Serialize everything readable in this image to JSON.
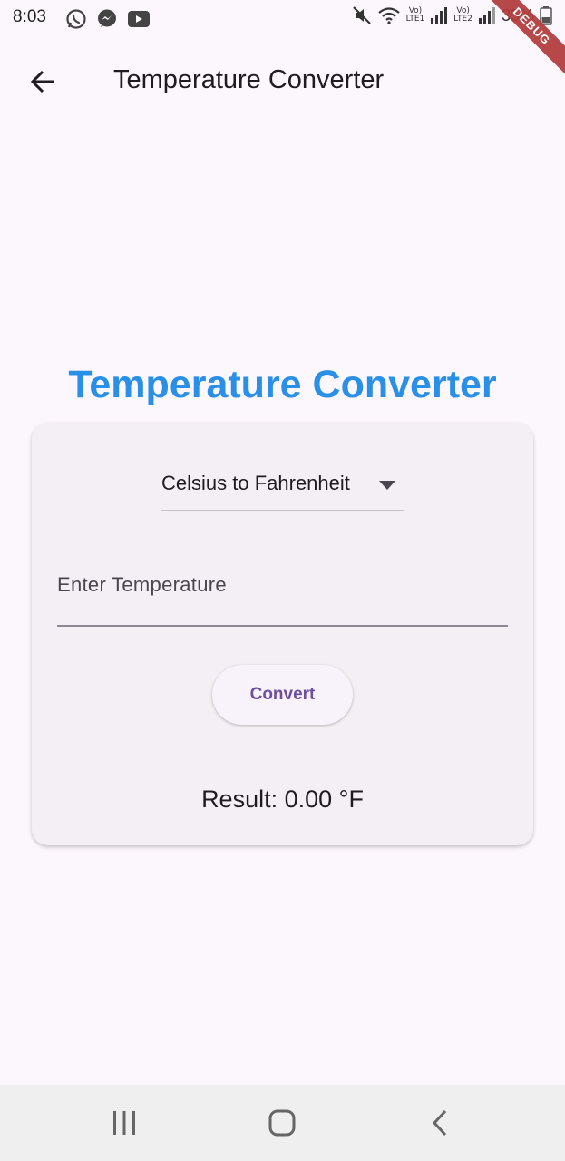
{
  "status_bar": {
    "time": "8:03",
    "left_icons": [
      "whatsapp-icon",
      "messenger-icon",
      "youtube-icon"
    ],
    "right_icons": [
      "mute-icon",
      "wifi-icon",
      "signal-lte1-icon",
      "signal-lte2-icon",
      "battery-icon"
    ],
    "lte1_label": "Vo) LTE1",
    "lte2_label": "Vo) LTE2",
    "battery_percent": "35%"
  },
  "debug_banner": "DEBUG",
  "app_bar": {
    "title": "Temperature Converter",
    "back_icon": "arrow-left-icon"
  },
  "main": {
    "heading": "Temperature Converter",
    "heading_color": "#2A8FE6",
    "dropdown": {
      "selected": "Celsius to Fahrenheit"
    },
    "input": {
      "placeholder": "Enter Temperature",
      "value": ""
    },
    "convert_label": "Convert",
    "result": "Result: 0.00 °F"
  },
  "nav_bar": {
    "recents_icon": "recents-icon",
    "home_icon": "home-icon",
    "back_icon": "chevron-left-icon"
  },
  "colors": {
    "background": "#FCF7FD",
    "card": "#F4EFF5",
    "button_text": "#6C4FA0"
  }
}
